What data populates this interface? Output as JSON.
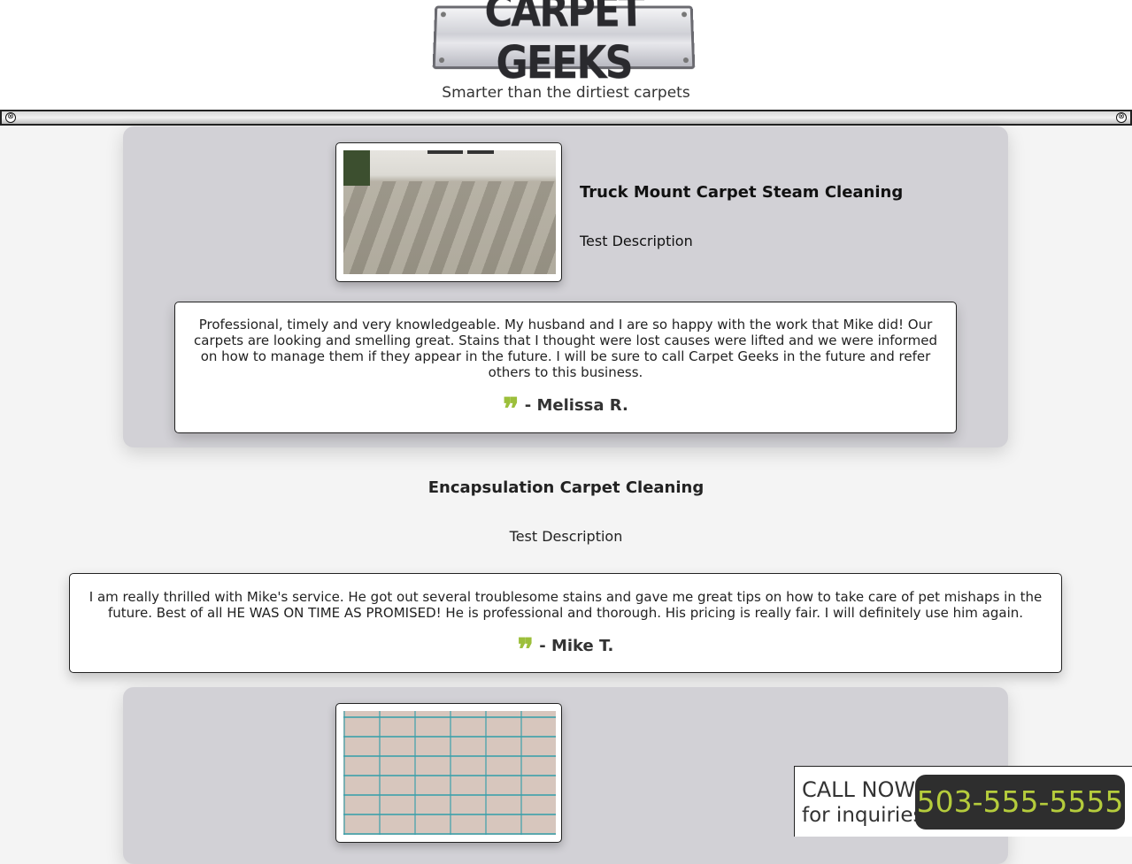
{
  "header": {
    "logo_text": "CARPET GEEKS",
    "tagline": "Smarter than the dirtiest carpets"
  },
  "toolbar": {
    "left_close": "⊗",
    "right_close": "⊗"
  },
  "services": [
    {
      "title": "Truck Mount Carpet Steam Cleaning",
      "description": "Test Description",
      "testimonial": {
        "text": "Professional, timely and very knowledgeable. My husband and I are so happy with the work that Mike did! Our carpets are looking and smelling great. Stains that I thought were lost causes were lifted and we were informed on how to manage them if they appear in the future. I will be sure to call Carpet Geeks in the future and refer others to this business.",
        "author": "- Melissa R."
      }
    },
    {
      "title": "Encapsulation Carpet Cleaning",
      "description": "Test Description",
      "testimonial": {
        "text": "I am really thrilled with Mike's service. He got out several troublesome stains and gave me great tips on how to take care of pet mishaps in the future. Best of all HE WAS ON TIME AS PROMISED! He is professional and thorough. His pricing is really fair. I will definitely use him again.",
        "author": "- Mike T."
      }
    }
  ],
  "quote_glyph": "❞",
  "cta": {
    "line1": "CALL NOW",
    "line2": "for inquiries",
    "phone": "503-555-5555"
  },
  "colors": {
    "accent_green": "#9cbf3b",
    "phone_bg": "#2e2e2e",
    "panel_bg": "#d2d1d6"
  }
}
